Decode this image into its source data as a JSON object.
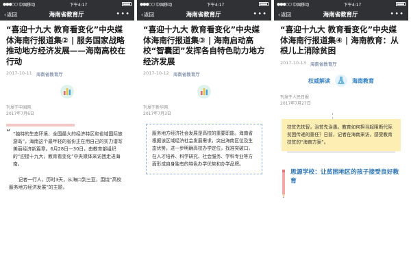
{
  "status": {
    "carrier": "中国移动",
    "time": "下午4:17",
    "battery": ""
  },
  "nav": {
    "back_label": "返回",
    "title": "海南省教育厅",
    "more": "•••"
  },
  "articles": [
    {
      "title": "“喜迎十九大 教育看变化”中央媒体海南行报道集② | 服务国家战略 推动地方经济发展——海南高校在行动",
      "date": "2017-10-11",
      "account": "海南省教育厅",
      "source_note": "刊发于中国网",
      "source_date": "2017年7月6日",
      "quote": "“独特的生态环境、全国最大的经济特区和省域国际旅游岛”，海南这个最年轻的省份正在用自己的实力谱写美丽经济新篇章。6月28日—30日，由教育部组织的“迎接十九大，教育看变化”中央媒体采访团走进海南。",
      "para": "记者一行人，历时3天，从海口到三亚，围绕“高校服务地方经济发展”的主题，"
    },
    {
      "title": "“喜迎十九大 教育看变化”中央媒体海南行报道集③ | 海南启动高校“智囊团”发挥各自特色助力地方经济发展",
      "date": "2017-10-12",
      "account": "海南省教育厅",
      "source_note": "刊发于新华网",
      "source_date": "2017年7月3日",
      "box": "服务地方经济社会发展是高校的重要职能。海南省根据该区域经济社会发展需求，突出海南区位及生态优势，进一步明确高校办学定位，找准突破口，在人才培养、科学研究、社会服务、学科专业等方面形成自身独有的特色办学优势和办学品牌。"
    },
    {
      "title": "“喜迎十九大 教育看变化”中央媒体海南行报道集④ | 海南教育：从根儿上消除贫困",
      "date": "2017-10-13",
      "account": "海南省教育厅",
      "heading_left": "权威解读",
      "heading_right": "海南教育",
      "source_note": "刊发于人民日报",
      "source_date": "2017年7月27日",
      "box": "扶贫先扶智，治贫先治愚。教育如何担当起阻断代际贫困传递的重任？日前，记者在海南采访，感受教育扶贫的“海南方案”。",
      "section": "思源学校：让贫困地区的孩子接受良好教育"
    }
  ],
  "colors": {
    "bar": "#2f3134",
    "link": "#576b95",
    "pink": "#f6c7c7",
    "yellow": "#fdeeb3",
    "blue": "#2a74b8"
  }
}
